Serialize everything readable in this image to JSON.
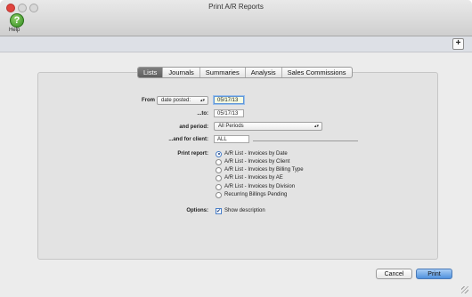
{
  "window": {
    "title": "Print A/R Reports"
  },
  "toolbar": {
    "help_label": "Help",
    "help_glyph": "?",
    "add_glyph": "+"
  },
  "tabs": [
    {
      "label": "Lists",
      "active": true
    },
    {
      "label": "Journals",
      "active": false
    },
    {
      "label": "Summaries",
      "active": false
    },
    {
      "label": "Analysis",
      "active": false
    },
    {
      "label": "Sales Commissions",
      "active": false
    }
  ],
  "form": {
    "from_label": "From",
    "from_select": "date posted:",
    "from_value": "05/17/13",
    "to_label": "...to:",
    "to_value": "05/17/13",
    "period_label": "and period:",
    "period_value": "All Periods",
    "client_label": "...and for client:",
    "client_value": "ALL",
    "print_report_label": "Print report:",
    "print_report_options": [
      "A/R List - Invoices by Date",
      "A/R List - Invoices by Client",
      "A/R List - Invoices by Billing Type",
      "A/R List - Invoices by AE",
      "A/R List - Invoices by Division",
      "Recurring Billings Pending"
    ],
    "print_report_selected": "A/R List - Invoices by Date",
    "options_label": "Options:",
    "show_description_label": "Show description",
    "show_description_checked": true
  },
  "buttons": {
    "cancel": "Cancel",
    "print": "Print"
  },
  "colors": {
    "accent": "#4f91dd",
    "help_green": "#2f8a1e",
    "close_red": "#e0443e"
  }
}
